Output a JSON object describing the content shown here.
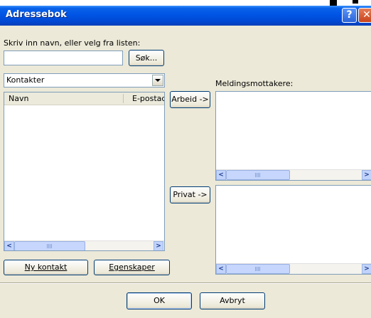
{
  "window": {
    "title": "Adressebok"
  },
  "search": {
    "prompt": "Skriv inn navn, eller velg fra listen:",
    "input_value": "",
    "button": "Søk..."
  },
  "source": {
    "selected": "Kontakter"
  },
  "contacts": {
    "columns": [
      "Navn",
      "E-postad"
    ],
    "rows": []
  },
  "recipients": {
    "label": "Meldingsmottakere:",
    "work_button": "Arbeid ->",
    "private_button": "Privat ->"
  },
  "actions": {
    "new_contact": "Ny kontakt",
    "properties": "Egenskaper",
    "ok": "OK",
    "cancel": "Avbryt"
  },
  "colors": {
    "titlebar": "#0054e3",
    "dialog": "#ece9d8"
  }
}
